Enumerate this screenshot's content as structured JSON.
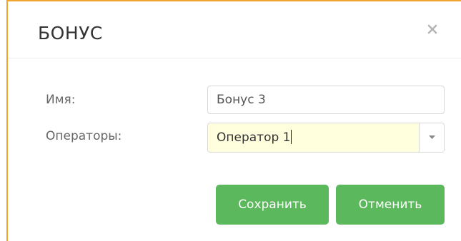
{
  "dialog": {
    "title": "БОНУС",
    "close_icon": "close-icon"
  },
  "form": {
    "name_label": "Имя:",
    "name_value": "Бонус 3",
    "operators_label": "Операторы:",
    "operators_value": "Оператор 1",
    "operators_dropdown_icon": "chevron-down-icon"
  },
  "actions": {
    "save_label": "Сохранить",
    "cancel_label": "Отменить"
  },
  "colors": {
    "accent_border": "#f2a431",
    "button_green": "#5cb85c",
    "input_highlight": "#ffffdd"
  }
}
